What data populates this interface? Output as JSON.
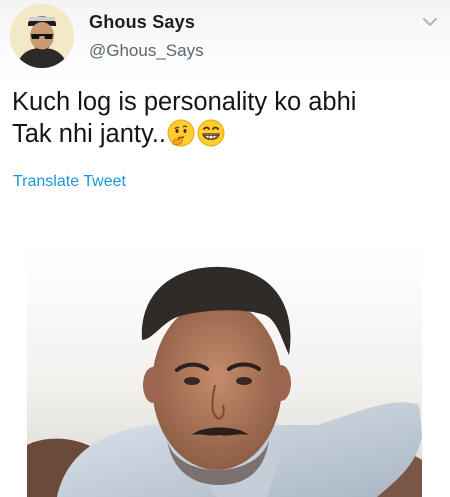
{
  "tweet": {
    "author_name": "Ghous Says",
    "author_handle": "@Ghous_Says",
    "text_line_1": "Kuch log is personality ko abhi",
    "text_line_2": "Tak nhi janty..",
    "translate_label": "Translate Tweet"
  },
  "icons": {
    "menu": "chevron-down-icon",
    "emoji_1": "thinking-face-icon",
    "emoji_2": "grinning-face-icon"
  },
  "colors": {
    "name": "#1c2022",
    "handle": "#5b6770",
    "link": "#1b95e0",
    "text": "#14171a"
  }
}
